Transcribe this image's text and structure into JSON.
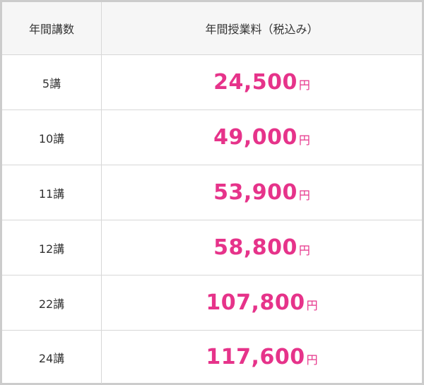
{
  "table": {
    "headers": {
      "count": "年間講数",
      "price": "年間授業料（税込み）"
    },
    "currency_suffix": "円",
    "accent_color": "#e6338a",
    "rows": [
      {
        "count": "5講",
        "price": "24,500"
      },
      {
        "count": "10講",
        "price": "49,000"
      },
      {
        "count": "11講",
        "price": "53,900"
      },
      {
        "count": "12講",
        "price": "58,800"
      },
      {
        "count": "22講",
        "price": "107,800"
      },
      {
        "count": "24講",
        "price": "117,600"
      }
    ]
  }
}
